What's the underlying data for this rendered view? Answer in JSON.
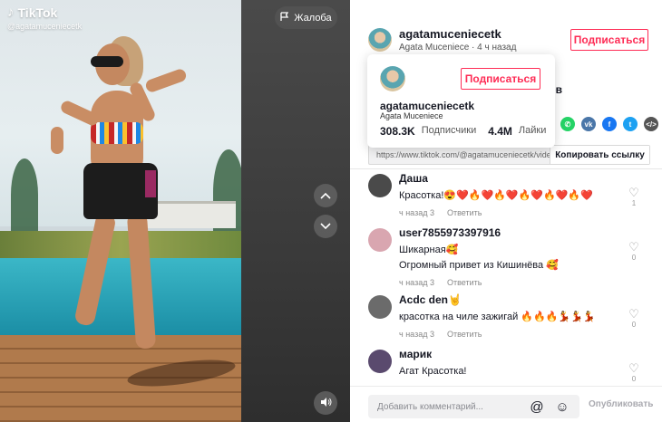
{
  "overlay": {
    "logo_text": "TikTok",
    "handle": "@agatamuceniecetk",
    "report_label": "Жалоба"
  },
  "author": {
    "username": "agatamuceniecetk",
    "subline": "Agata Muceniece · 4 ч назад",
    "follow_label": "Подписаться",
    "hidden_desc_fragment": "нов"
  },
  "popup": {
    "username": "agatamuceniecetk",
    "display_name": "Agata Muceniece",
    "follow_label": "Подписаться",
    "followers_count": "308.3K",
    "followers_label": "Подписчики",
    "likes_count": "4.4M",
    "likes_label": "Лайки"
  },
  "share": {
    "icons": [
      {
        "name": "whatsapp-icon",
        "glyph": "✆",
        "color": "#25d366"
      },
      {
        "name": "vk-icon",
        "glyph": "vk",
        "color": "#4a76a8"
      },
      {
        "name": "facebook-icon",
        "glyph": "f",
        "color": "#1877f2"
      },
      {
        "name": "twitter-icon",
        "glyph": "t",
        "color": "#1da1f2"
      },
      {
        "name": "embed-icon",
        "glyph": "</>",
        "color": "#555555"
      }
    ],
    "link": "https://www.tiktok.com/@agatamuceniecetk/video/",
    "copy_label": "Копировать ссылку"
  },
  "comments": [
    {
      "name": "Даша",
      "text": [
        "Красотка!😍❤️🔥❤️🔥❤️🔥❤️🔥❤️🔥❤️"
      ],
      "time": "ч назад 3",
      "reply": "Ответить",
      "likes": "1",
      "avatar_color": "#4a4a4a"
    },
    {
      "name": "user7855973397916",
      "text": [
        "Шикарная🥰",
        "Огромный привет из Кишинёва 🥰"
      ],
      "time": "ч назад 3",
      "reply": "Ответить",
      "likes": "0",
      "avatar_color": "#d9a6b0"
    },
    {
      "name": "Acdc den🤘",
      "text": [
        "красотка на чиле зажигай 🔥🔥🔥💃💃💃"
      ],
      "time": "ч назад 3",
      "reply": "Ответить",
      "likes": "0",
      "avatar_color": "#6b6b6b"
    },
    {
      "name": "марик",
      "text": [
        "Агат Красотка!"
      ],
      "time": "",
      "reply": "",
      "likes": "0",
      "avatar_color": "#5a4a6e"
    }
  ],
  "footer": {
    "placeholder": "Добавить комментарий...",
    "mention_icon": "@",
    "emoji_icon": "☺",
    "post_label": "Опубликовать"
  }
}
